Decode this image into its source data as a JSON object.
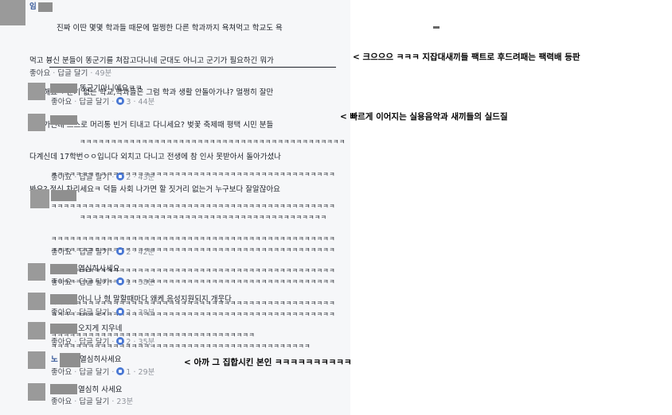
{
  "main_comment": {
    "author_initial": "임",
    "body_lines": [
      "  진짜 이딴 몇몇 학과들 때문에 멀쩡한 다른 학과까지 욕쳐먹고 학교도 욕",
      "먹고 븅신 분들이 똥군기를 쳐잡고다니네 군대도 아니고 군기가 필요하긴 뭐가",
      "필요해요ㅋ 군기 없는 학교,학과들은 그럼 학과 생활 안돌아가냐? 멀쩡히 잘만",
      "돌아가던데 스스로 머리통 빈거 티내고 다니세요? 벚꽃 축제때 평택 시민 분들",
      "다계신데 17학번ㅇㅇ입니다 외치고 다니고 전생에 참 인사 못받아서 돌아가셨나",
      "봐요? 정신 차리세요ㅋ 덕들 사회 나가면 할 짓거리 없는거 누구보다 잘알잖아요"
    ],
    "actions": {
      "like": "좋아요",
      "reply": "답글 달기",
      "time": "49분"
    }
  },
  "replies": [
    {
      "author_initial": "",
      "body": "똥군기아니에요ㅋㅋ",
      "likes": "3",
      "time": "44분"
    },
    {
      "author_initial": "",
      "body_lines": [
        "ㅋㅋㅋㅋㅋㅋㅋㅋㅋㅋㅋㅋㅋㅋㅋㅋㅋㅋㅋㅋㅋㅋㅋㅋㅋㅋㅋㅋㅋㅋㅋㅋㅋㅋㅋㅋㅋㅋㅋㅋㅋㅋㅋ",
        "ㅋㅋㅋㅋㅋㅋㅋㅋㅋㅋㅋㅋㅋㅋㅋㅋㅋㅋㅋㅋㅋㅋㅋㅋㅋㅋㅋㅋㅋㅋㅋㅋㅋㅋㅋㅋㅋㅋㅋㅋㅋㅋㅋㅋㅋㅋ",
        "ㅋㅋㅋㅋㅋㅋㅋㅋㅋㅋㅋㅋㅋㅋㅋㅋㅋㅋㅋㅋㅋㅋㅋㅋㅋㅋㅋㅋㅋㅋㅋㅋㅋㅋㅋㅋㅋㅋㅋㅋㅋㅋㅋㅋㅋㅋ",
        "ㅋㅋㅋㅋㅋㅋㅋㅋㅋㅋㅋㅋㅋㅋㅋㅋㅋㅋㅋㅋㅋㅋㅋㅋㅋㅋㅋㅋㅋㅋㅋㅋㅋㅋㅋㅋㅋㅋㅋㅋㅋㅋㅋㅋㅋㅋ",
        "ㅋㅋㅋㅋㅋㅋㅋㅋㅋㅋㅋㅋㅋㅋㅋㅋㅋㅋㅋㅋㅋㅋㅋㅋㅋㅋㅋㅋㅋㅋㅋㅋㅋㅋㅋㅋㅋㅋㅋㅋㅋㅋㅋㅋㅋㅋ",
        "ㅋㅋㅋㅋㅋㅋㅋㅋㅋㅋㅋㅋㅋㅋㅋㅋㅋㅋㅋㅋㅋㅋㅋㅋㅋㅋㅋㅋㅋㅋㅋㅋㅋㅋㅋㅋㅋㅋㅋㅋㅋㅋㅋㅋㅋㅋ",
        "ㅋㅋㅋㅋㅋㅋㅋㅋㅋㅋㅋㅋㅋㅋㅋㅋㅋㅋㅋㅋㅋㅋㅋㅋㅋㅋㅋㅋㅋㅋㅋㅋㅋ"
      ],
      "likes": "2",
      "time": "43분"
    },
    {
      "author_initial": "",
      "body_lines": [
        "ㅋㅋㅋㅋㅋㅋㅋㅋㅋㅋㅋㅋㅋㅋㅋㅋㅋㅋㅋㅋㅋㅋㅋㅋㅋㅋㅋㅋㅋㅋㅋㅋㅋㅋㅋㅋㅋㅋㅋㅋ",
        "ㅋㅋㅋㅋㅋㅋㅋㅋㅋㅋㅋㅋㅋㅋㅋㅋㅋㅋㅋㅋㅋㅋㅋㅋㅋㅋㅋㅋㅋㅋㅋㅋㅋㅋㅋㅋㅋㅋㅋㅋㅋㅋㅋㅋㅋㅋ",
        "ㅋㅋㅋㅋㅋㅋㅋㅋㅋㅋㅋㅋㅋㅋㅋㅋㅋㅋㅋㅋㅋㅋㅋㅋㅋㅋㅋㅋㅋㅋㅋㅋㅋㅋㅋㅋㅋㅋㅋㅋㅋㅋㅋㅋㅋㅋ",
        "ㅋㅋㅋㅋㅋㅋㅋㅋㅋㅋㅋㅋㅋㅋㅋㅋㅋㅋㅋㅋㅋㅋㅋㅋㅋㅋㅋㅋㅋㅋㅋㅋㅋㅋㅋㅋㅋㅋㅋㅋㅋㅋㅋㅋㅋㅋ",
        "ㅋㅋㅋㅋㅋㅋㅋㅋㅋㅋㅋㅋㅋㅋㅋㅋㅋㅋㅋㅋㅋㅋㅋㅋㅋㅋㅋㅋㅋㅋㅋㅋㅋㅋㅋㅋㅋㅋㅋㅋㅋㅋ"
      ],
      "likes": "2",
      "time": "42분"
    },
    {
      "author_initial": "",
      "body": "열심히사세요",
      "likes": "1",
      "time": "38분"
    },
    {
      "author_initial": "",
      "body": "아니 나 형 말할때마다 왜케 음성지원되지 개웃다",
      "likes": "2",
      "time": "38분"
    },
    {
      "author_initial": "",
      "body": "오지게 지우네",
      "likes": "2",
      "time": "35분"
    },
    {
      "author_initial": "노",
      "body": "열심히사세요",
      "likes": "1",
      "time": "29분"
    },
    {
      "author_initial": "",
      "body": "열심히 사세요",
      "likes": "",
      "time": "23분"
    }
  ],
  "reply_actions": {
    "like": "좋아요",
    "reply": "답글 달기",
    "sep": "·"
  },
  "annotations": [
    "< 크으으으 ㅋㅋㅋ 지잡대새끼들 팩트로 후드려패는 팩력배 등판",
    "< 빠르게 이어지는 실용음악과 새끼들의 실드질",
    "< 아까 그 집합시킨 본인 ㅋㅋㅋㅋㅋㅋㅋㅋㅋㅋ"
  ],
  "colors": {
    "panel_bg": "#f6f7f9",
    "text": "#1d2129",
    "meta": "#90949c",
    "like_blue": "#4a78d4"
  }
}
